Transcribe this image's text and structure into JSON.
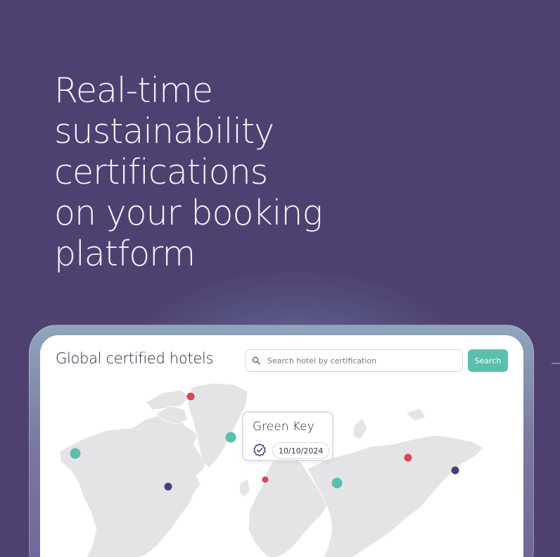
{
  "hero": {
    "lines": [
      "Real-time",
      "sustainability",
      "certifications",
      "on your booking",
      "platform"
    ]
  },
  "panel": {
    "title": "Global certified hotels",
    "search_placeholder": "Search hotel by certification",
    "search_button": "Search"
  },
  "popup": {
    "title": "Green Key",
    "date": "10/10/2024",
    "icon": "verified-badge-icon"
  },
  "markers": [
    {
      "name": "marker-greenland-north",
      "color": "#d94655"
    },
    {
      "name": "marker-alaska",
      "color": "#5bbfad"
    },
    {
      "name": "marker-greenland-east",
      "color": "#5bbfad"
    },
    {
      "name": "marker-canada",
      "color": "#4a3d78"
    },
    {
      "name": "marker-scandinavia",
      "color": "#d94655"
    },
    {
      "name": "marker-russia-west",
      "color": "#5bbfad"
    },
    {
      "name": "marker-siberia",
      "color": "#d94655"
    },
    {
      "name": "marker-far-east",
      "color": "#4a3d78"
    }
  ],
  "colors": {
    "background": "#4e4070",
    "accent": "#5bbfad",
    "red": "#d94655",
    "purple": "#4a3d78",
    "land": "#e4e4e6"
  }
}
